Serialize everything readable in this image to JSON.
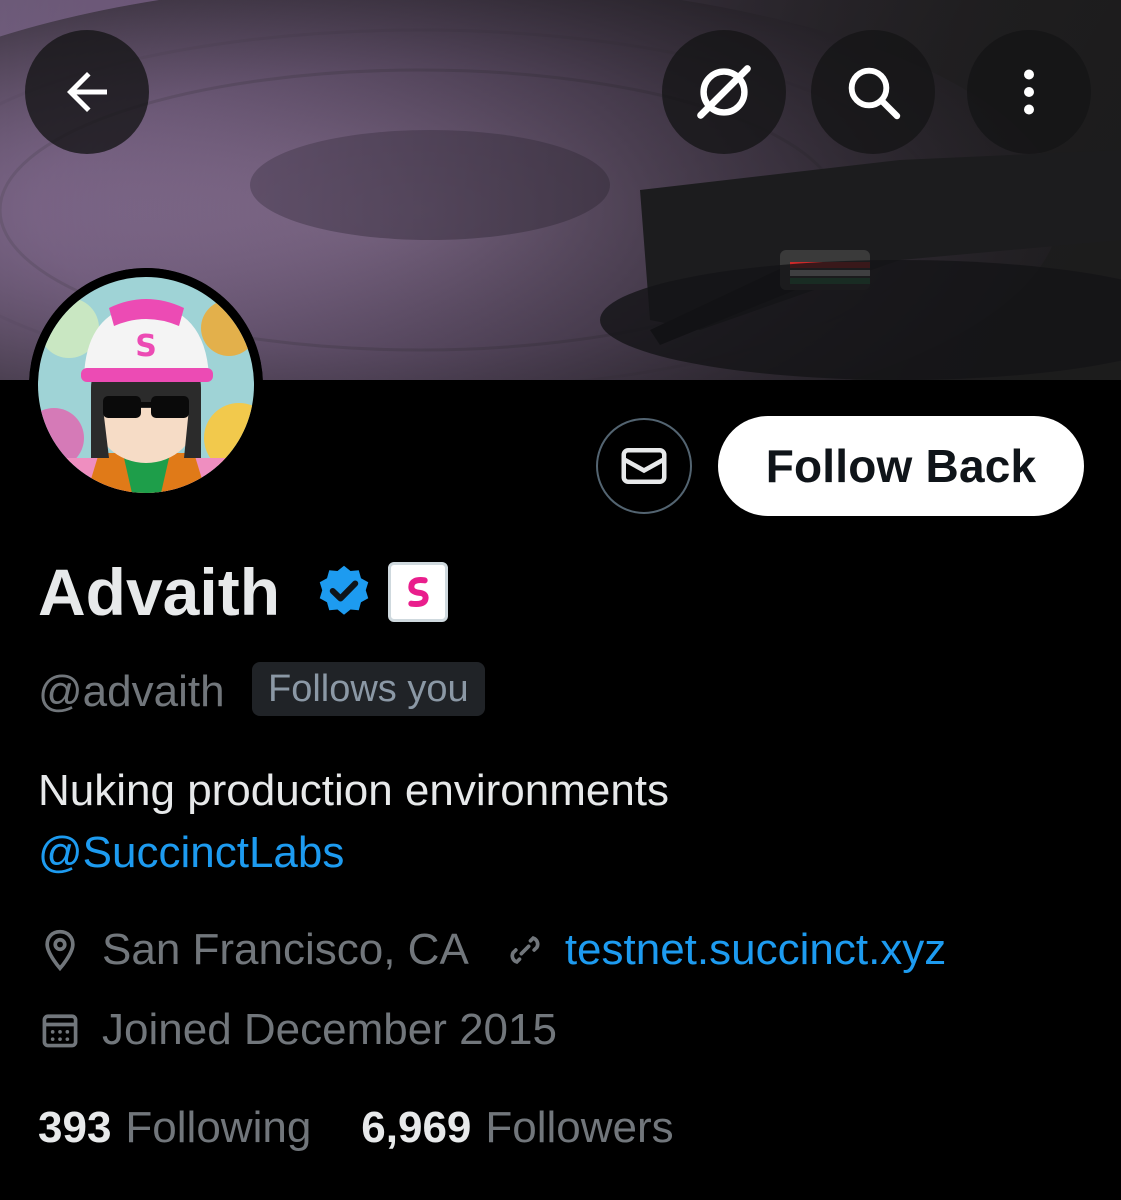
{
  "header": {
    "back_icon": "arrow-left-icon",
    "grok_icon": "slashed-circle-icon",
    "search_icon": "search-icon",
    "more_icon": "more-vertical-icon"
  },
  "profile": {
    "display_name": "Advaith",
    "handle": "@advaith",
    "follows_you_label": "Follows you",
    "bio_text": "Nuking production environments",
    "bio_mention": "@SuccinctLabs",
    "location": "San Francisco, CA",
    "website": "testnet.succinct.xyz",
    "joined": "Joined December 2015"
  },
  "actions": {
    "message_icon": "envelope-icon",
    "follow_label": "Follow Back"
  },
  "stats": {
    "following_count": "393",
    "following_label": "Following",
    "followers_count": "6,969",
    "followers_label": "Followers"
  },
  "colors": {
    "background": "#000000",
    "link": "#1d9bf0",
    "muted": "#71767b",
    "primary_text": "#e7e9ea",
    "verified": "#1d9bf0",
    "affiliate_pink": "#e91e8c"
  }
}
